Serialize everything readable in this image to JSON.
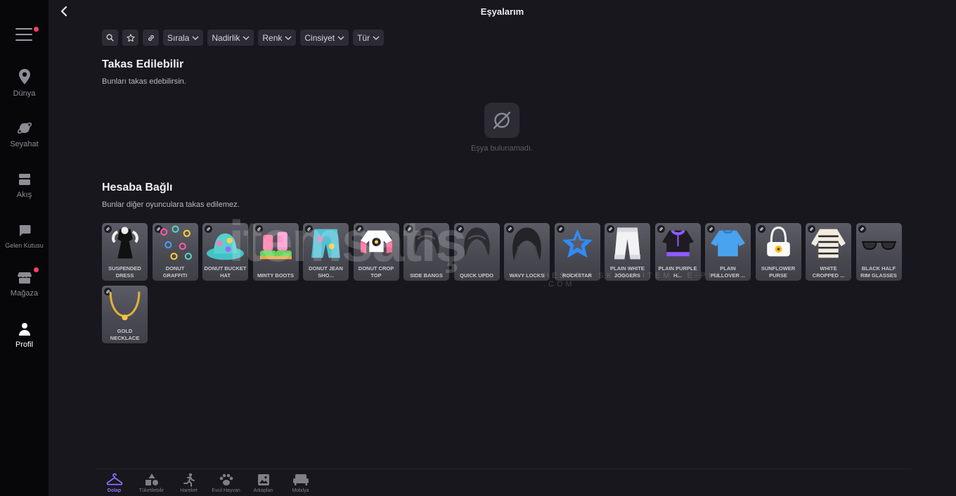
{
  "header": {
    "title": "Eşyalarım"
  },
  "sidebar": {
    "items": [
      {
        "key": "world",
        "label": "Dünya",
        "icon": "map-pin-icon",
        "active": false
      },
      {
        "key": "travel",
        "label": "Seyahat",
        "icon": "planet-icon",
        "active": false
      },
      {
        "key": "feed",
        "label": "Akış",
        "icon": "feed-icon",
        "active": false
      },
      {
        "key": "inbox",
        "label": "Gelen Kutusu",
        "icon": "chat-icon",
        "active": false
      },
      {
        "key": "shop",
        "label": "Mağaza",
        "icon": "store-icon",
        "active": false
      },
      {
        "key": "profile",
        "label": "Profil",
        "icon": "person-icon",
        "active": true
      }
    ]
  },
  "filters": {
    "sort": "Sırala",
    "rarity": "Nadirlik",
    "color": "Renk",
    "gender": "Cinsiyet",
    "type": "Tür"
  },
  "tradable": {
    "title": "Takas Edilebilir",
    "subtitle": "Bunları takas edebilirsin.",
    "empty_text": "Eşya bulunamadı."
  },
  "bound": {
    "title": "Hesaba Bağlı",
    "subtitle": "Bunlar diğer oyunculara takas edilemez.",
    "items": [
      {
        "name": "SUSPENDED DRESS",
        "art": "dress"
      },
      {
        "name": "DONUT GRAFFITI",
        "art": "graffiti"
      },
      {
        "name": "DONUT BUCKET HAT",
        "art": "hat"
      },
      {
        "name": "MINTY BOOTS",
        "art": "boots"
      },
      {
        "name": "DONUT JEAN SHO...",
        "art": "shorts"
      },
      {
        "name": "DONUT CROP TOP",
        "art": "croptop"
      },
      {
        "name": "SIDE BANGS",
        "art": "hair"
      },
      {
        "name": "QUICK UPDO",
        "art": "hair"
      },
      {
        "name": "WAVY LOCKS",
        "art": "hairlong"
      },
      {
        "name": "ROCKSTAR",
        "art": "star"
      },
      {
        "name": "PLAIN WHITE JOGGERS",
        "art": "joggers"
      },
      {
        "name": "PLAIN PURPLE H...",
        "art": "hoodie"
      },
      {
        "name": "PLAIN PULLOVER ...",
        "art": "pullover"
      },
      {
        "name": "SUNFLOWER PURSE",
        "art": "purse"
      },
      {
        "name": "WHITE CROPPED ...",
        "art": "sweater"
      },
      {
        "name": "BLACK HALF RIM GLASSES",
        "art": "glasses"
      },
      {
        "name": "GOLD NECKLACE",
        "art": "necklace"
      }
    ]
  },
  "watermark": {
    "text": "itemsatış",
    "sub": "HESAP / SKIN / ITEM / E-PIN .COM"
  },
  "bottom_tabs": [
    {
      "label": "Dolap",
      "icon": "hanger-icon",
      "active": true
    },
    {
      "label": "Tüketilebilir",
      "icon": "shapes-icon",
      "active": false
    },
    {
      "label": "Hareket",
      "icon": "running-icon",
      "active": false
    },
    {
      "label": "Evcil Hayvan",
      "icon": "paw-icon",
      "active": false
    },
    {
      "label": "Arkaplan",
      "icon": "image-icon",
      "active": false
    },
    {
      "label": "Mobilya",
      "icon": "sofa-icon",
      "active": false
    }
  ],
  "colors": {
    "accent": "#8d6dff",
    "notification": "#ff3e6c",
    "background": "#18171d",
    "sidebar": "#070709"
  }
}
